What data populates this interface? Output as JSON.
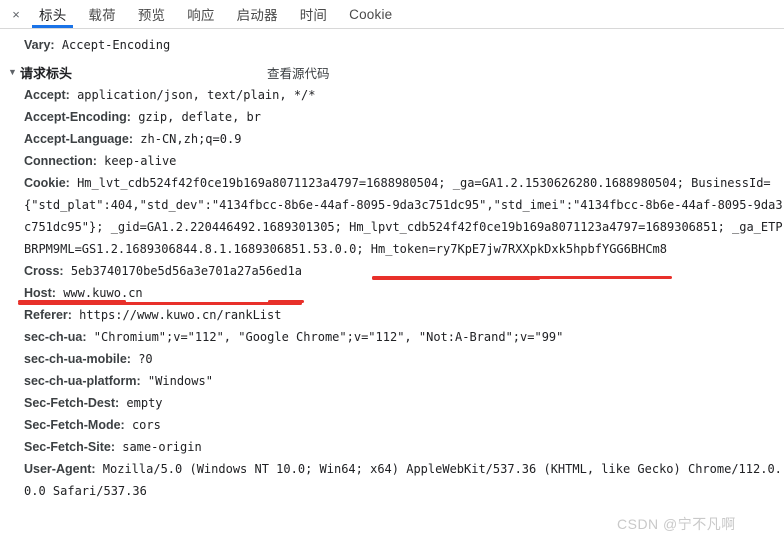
{
  "tabbar": {
    "close_icon": "×",
    "tabs": [
      {
        "label": "标头",
        "active": true
      },
      {
        "label": "载荷",
        "active": false
      },
      {
        "label": "预览",
        "active": false
      },
      {
        "label": "响应",
        "active": false
      },
      {
        "label": "启动器",
        "active": false
      },
      {
        "label": "时间",
        "active": false
      },
      {
        "label": "Cookie",
        "active": false
      }
    ],
    "accent_color": "#1a73e8"
  },
  "top_header": {
    "name": "Vary:",
    "value": "Accept-Encoding"
  },
  "request_headers_section": {
    "caret": "▼",
    "title": "请求标头",
    "view_source_label": "查看源代码"
  },
  "headers": [
    {
      "name": "Accept:",
      "value": "application/json, text/plain, */*"
    },
    {
      "name": "Accept-Encoding:",
      "value": "gzip, deflate, br"
    },
    {
      "name": "Accept-Language:",
      "value": "zh-CN,zh;q=0.9"
    },
    {
      "name": "Connection:",
      "value": "keep-alive"
    },
    {
      "name": "Cookie:",
      "value": "Hm_lvt_cdb524f42f0ce19b169a8071123a4797=1688980504; _ga=GA1.2.1530626280.1688980504; BusinessId="
    },
    {
      "name": "",
      "value": "{\"std_plat\":404,\"std_dev\":\"4134fbcc-8b6e-44af-8095-9da3c751dc95\",\"std_imei\":\"4134fbcc-8b6e-44af-8095-9da3"
    },
    {
      "name": "",
      "value": "c751dc95\"}; _gid=GA1.2.220446492.1689301305; Hm_lpvt_cdb524f42f0ce19b169a8071123a4797=1689306851; _ga_ETP"
    },
    {
      "name": "",
      "value": "BRPM9ML=GS1.2.1689306844.8.1.1689306851.53.0.0; Hm_token=ry7KpE7jw7RXXpkDxk5hpbfYGG6BHCm8"
    },
    {
      "name": "Cross:",
      "value": "5eb3740170be5d56a3e701a27a56ed1a"
    },
    {
      "name": "Host:",
      "value": "www.kuwo.cn"
    },
    {
      "name": "Referer:",
      "value": "https://www.kuwo.cn/rankList"
    },
    {
      "name": "sec-ch-ua:",
      "value": "\"Chromium\";v=\"112\", \"Google Chrome\";v=\"112\", \"Not:A-Brand\";v=\"99\""
    },
    {
      "name": "sec-ch-ua-mobile:",
      "value": "?0"
    },
    {
      "name": "sec-ch-ua-platform:",
      "value": "\"Windows\""
    },
    {
      "name": "Sec-Fetch-Dest:",
      "value": "empty"
    },
    {
      "name": "Sec-Fetch-Mode:",
      "value": "cors"
    },
    {
      "name": "Sec-Fetch-Site:",
      "value": "same-origin"
    },
    {
      "name": "User-Agent:",
      "value": "Mozilla/5.0 (Windows NT 10.0; Win64; x64) AppleWebKit/537.36 (KHTML, like Gecko) Chrome/112.0."
    },
    {
      "name": "",
      "value": "0.0 Safari/537.36"
    }
  ],
  "annotations": {
    "color": "#e8302a",
    "underlined_tokens": [
      "Hm_token=ry7KpE7jw7RXXpkDxk5hpbfYGG6BHCm8",
      "Cross: 5eb3740170be5d56a3e701a27a56ed1a"
    ]
  },
  "watermark": {
    "text": "CSDN @宁不凡啊"
  }
}
